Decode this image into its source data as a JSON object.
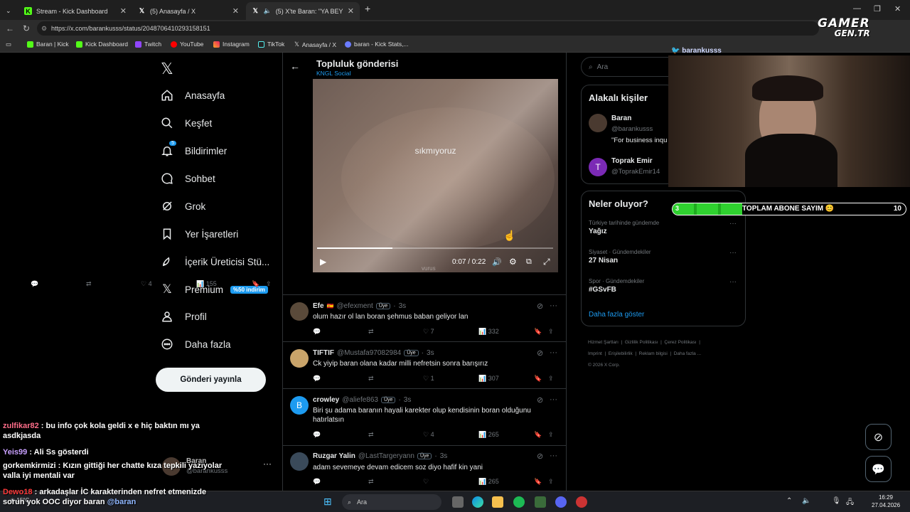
{
  "browser": {
    "tabs": [
      {
        "icon": "kick-icon",
        "label": "Stream - Kick Dashboard"
      },
      {
        "icon": "x-icon",
        "label": "(5) Anasayfa / X"
      },
      {
        "icon": "x-icon",
        "label": "(5) X'te Baran: \"YA BEYLER RO"
      }
    ],
    "url": "https://x.com/barankusss/status/2048706410293158151",
    "bookmarks": [
      "Baran | Kick",
      "Kick Dashboard",
      "Twitch",
      "YouTube",
      "Instagram",
      "TikTok",
      "Anasayfa / X",
      "baran - Kick Stats,..."
    ]
  },
  "logo": {
    "line1": "GAMER",
    "line2": "GEN.TR"
  },
  "nav": {
    "items": [
      {
        "icon": "home-icon",
        "label": "Anasayfa"
      },
      {
        "icon": "search-icon",
        "label": "Keşfet"
      },
      {
        "icon": "bell-icon",
        "label": "Bildirimler",
        "badge": "5"
      },
      {
        "icon": "chat-icon",
        "label": "Sohbet"
      },
      {
        "icon": "grok-icon",
        "label": "Grok"
      },
      {
        "icon": "bookmark-icon",
        "label": "Yer İşaretleri"
      },
      {
        "icon": "rocket-icon",
        "label": "İçerik Üreticisi Stü..."
      },
      {
        "icon": "x-icon",
        "label": "Premium",
        "promo": "%50 indirim"
      },
      {
        "icon": "profile-icon",
        "label": "Profil"
      },
      {
        "icon": "more-icon",
        "label": "Daha fazla"
      }
    ],
    "post_button": "Gönderi yayınla",
    "account": {
      "name": "Baran",
      "handle": "@barankusss"
    }
  },
  "post": {
    "title": "Topluluk gönderisi",
    "community": "KNGL Social",
    "video": {
      "caption": "sıkmıyoruz",
      "time": "0:07 / 0:22",
      "progress": 0.32,
      "watermark": "vurus"
    },
    "stats": {
      "likes": "4",
      "views": "155"
    }
  },
  "replies": [
    {
      "name": "Efe",
      "flag": "🇪🇸",
      "handle": "@efexment",
      "badge": "Üye",
      "time": "3s",
      "text": "olum hazır ol lan boran şehmus baban geliyor lan",
      "likes": "7",
      "views": "332",
      "avatar_color": "#5a4a3a"
    },
    {
      "name": "TIFTIF",
      "handle": "@Mustafa97082984",
      "badge": "Üye",
      "time": "3s",
      "text": "Ck yiyip baran olana kadar milli nefretsin sonra barışırız",
      "likes": "1",
      "views": "307",
      "avatar_color": "#c9a46a"
    },
    {
      "name": "crowley",
      "handle": "@aliefe863",
      "badge": "Üye",
      "time": "3s",
      "text": "Biri şu adama baranın hayali karekter olup kendisinin boran olduğunu hatırlatsın",
      "likes": "4",
      "views": "265",
      "avatar_color": "#1d9bf0",
      "avatar_letter": "B"
    },
    {
      "name": "Ruzgar Yalin",
      "handle": "@LastTargeryann",
      "badge": "Üye",
      "time": "3s",
      "text": "adam sevemeye devam edicem soz diyo  hafif kin yani",
      "likes": "",
      "views": "265",
      "avatar_color": "#3a4a5a"
    }
  ],
  "right": {
    "search_placeholder": "Ara",
    "relevant_title": "Alakalı kişiler",
    "people": [
      {
        "name": "Baran",
        "handle": "@barankusss",
        "bio": "\"For business inqu",
        "avatar_color": "#4a3a30"
      },
      {
        "name": "Toprak Emir",
        "handle": "@ToprakEmir14",
        "avatar_letter": "T",
        "avatar_color": "#7b2ab5"
      }
    ],
    "trends_title": "Neler oluyor?",
    "trends": [
      {
        "sub": "Türkiye tarihinde gündemde",
        "value": "Yağız"
      },
      {
        "sub": "Siyaset · Gündemdekiler",
        "value": "27 Nisan"
      },
      {
        "sub": "Spor · Gündemdekiler",
        "value": "#GSvFB"
      }
    ],
    "more": "Daha fazla göster",
    "footer": [
      "Hizmet Şartları",
      "Gizlilik Politikası",
      "Çerez Politikası",
      "Imprint",
      "Erişilebilirlik",
      "Reklam bilgisi",
      "Daha fazla ...",
      "© 2026 X Corp."
    ]
  },
  "overlay": {
    "cam_handle": "barankusss",
    "sub_goal": {
      "label": "TOPLAM ABONE SAYIM 😊",
      "current": "3",
      "target": "10",
      "progress": 0.3
    }
  },
  "chat": [
    {
      "user": "zulfikar82",
      "color": "#ff6e8a",
      "text": "bu info çok kola geldi x e hiç baktın mı ya asdkjasda"
    },
    {
      "user": "Yeis99",
      "color": "#c9a0ff",
      "text": "Ali Ss gösterdi"
    },
    {
      "user": "gorkemkirmizi",
      "color": "#ffffff",
      "text": "Kızın gittiği her chatte kıza tepkili yazıyolar valla iyi mentali var"
    },
    {
      "user": "Dewo18",
      "color": "#ff3b3b",
      "text": "arkadaşlar İC karakterinden nefret etmenizde sorun yok OOC diyor baran",
      "mention": "@baran"
    }
  ],
  "taskbar": {
    "search": "Ara",
    "weather": "15°C",
    "time": "16:29",
    "date": "27.04.2026"
  }
}
